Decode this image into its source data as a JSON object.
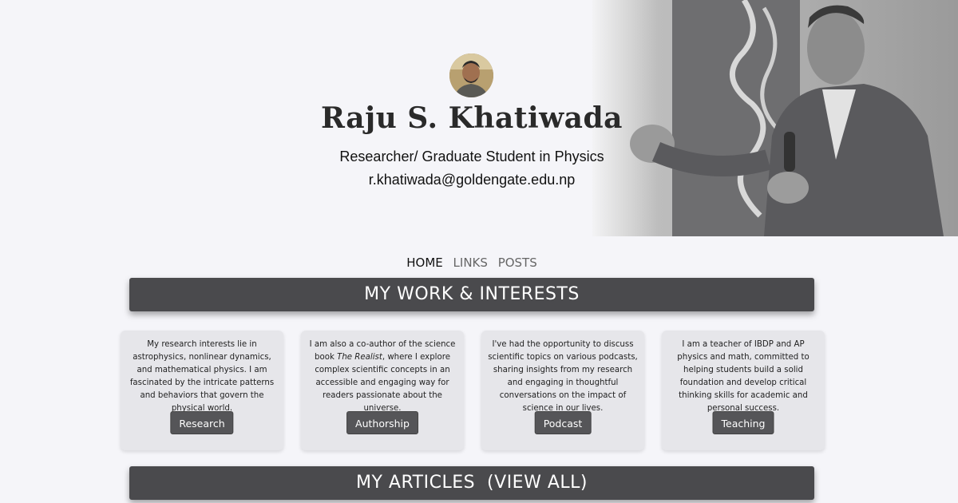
{
  "header": {
    "name": "Raju S. Khatiwada",
    "subtitle": "Researcher/ Graduate Student in Physics",
    "email": "r.khatiwada@goldengate.edu.np"
  },
  "nav": {
    "items": [
      {
        "label": "HOME",
        "active": true
      },
      {
        "label": "LINKS",
        "active": false
      },
      {
        "label": "POSTS",
        "active": false
      }
    ]
  },
  "sections": {
    "work_title": "MY WORK & INTERESTS",
    "articles_title": "MY ARTICLES  (VIEW ALL)"
  },
  "cards": [
    {
      "text": "My research interests lie in astrophysics, nonlinear dynamics, and mathematical physics. I am fascinated by the intricate patterns and behaviors that govern the physical world.",
      "button": "Research"
    },
    {
      "text_before": "I am also a co-author of the science book ",
      "text_italic": "The Realist",
      "text_after": ", where I explore complex scientific concepts in an accessible and engaging way for readers passionate about the universe.",
      "button": "Authorship"
    },
    {
      "text": "I've had the opportunity to discuss scientific topics on various podcasts, sharing insights from my research and engaging in thoughtful conversations on the impact of science in our lives.",
      "button": "Podcast"
    },
    {
      "text": "I am a teacher of IBDP and AP physics and math, committed to helping students build a solid foundation and develop critical thinking skills for academic and personal success.",
      "button": "Teaching"
    }
  ],
  "colors": {
    "background": "#f5f5f9",
    "bar": "#4a4a4d",
    "card": "#e6e6ea",
    "button": "#555558"
  }
}
